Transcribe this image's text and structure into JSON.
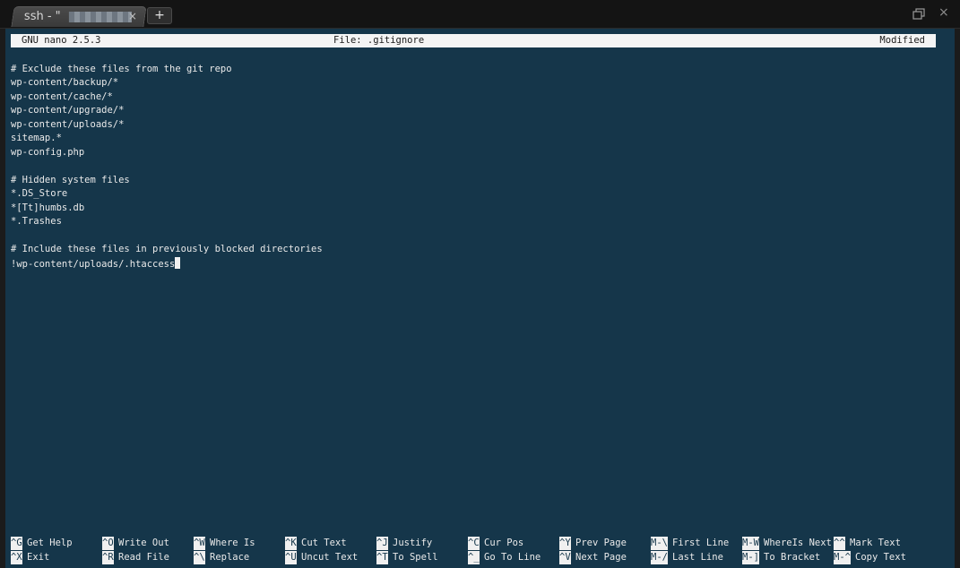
{
  "tab": {
    "title": "ssh - \"",
    "close_glyph": "×",
    "new_tab_glyph": "+"
  },
  "window_controls": {
    "close_glyph": "×"
  },
  "nano": {
    "header": {
      "version": "GNU nano 2.5.3",
      "file": "File: .gitignore",
      "status": "Modified"
    },
    "lines": [
      "",
      "# Exclude these files from the git repo",
      "wp-content/backup/*",
      "wp-content/cache/*",
      "wp-content/upgrade/*",
      "wp-content/uploads/*",
      "sitemap.*",
      "wp-config.php",
      "",
      "# Hidden system files",
      "*.DS_Store",
      "*[Tt]humbs.db",
      "*.Trashes",
      "",
      "# Include these files in previously blocked directories",
      "!wp-content/uploads/.htaccess"
    ],
    "shortcuts_row1": [
      {
        "key": "^G",
        "label": "Get Help"
      },
      {
        "key": "^O",
        "label": "Write Out"
      },
      {
        "key": "^W",
        "label": "Where Is"
      },
      {
        "key": "^K",
        "label": "Cut Text"
      },
      {
        "key": "^J",
        "label": "Justify"
      },
      {
        "key": "^C",
        "label": "Cur Pos"
      },
      {
        "key": "^Y",
        "label": "Prev Page"
      },
      {
        "key": "M-\\",
        "label": "First Line"
      },
      {
        "key": "M-W",
        "label": "WhereIs Next"
      },
      {
        "key": "^^",
        "label": "Mark Text"
      }
    ],
    "shortcuts_row2": [
      {
        "key": "^X",
        "label": "Exit"
      },
      {
        "key": "^R",
        "label": "Read File"
      },
      {
        "key": "^\\",
        "label": "Replace"
      },
      {
        "key": "^U",
        "label": "Uncut Text"
      },
      {
        "key": "^T",
        "label": "To Spell"
      },
      {
        "key": "^_",
        "label": "Go To Line"
      },
      {
        "key": "^V",
        "label": "Next Page"
      },
      {
        "key": "M-/",
        "label": "Last Line"
      },
      {
        "key": "M-]",
        "label": "To Bracket"
      },
      {
        "key": "M-^",
        "label": "Copy Text"
      }
    ]
  },
  "colors": {
    "terminal_bg": "#15364a",
    "text": "#eaeaea",
    "header_bg": "#f4f4f4"
  }
}
